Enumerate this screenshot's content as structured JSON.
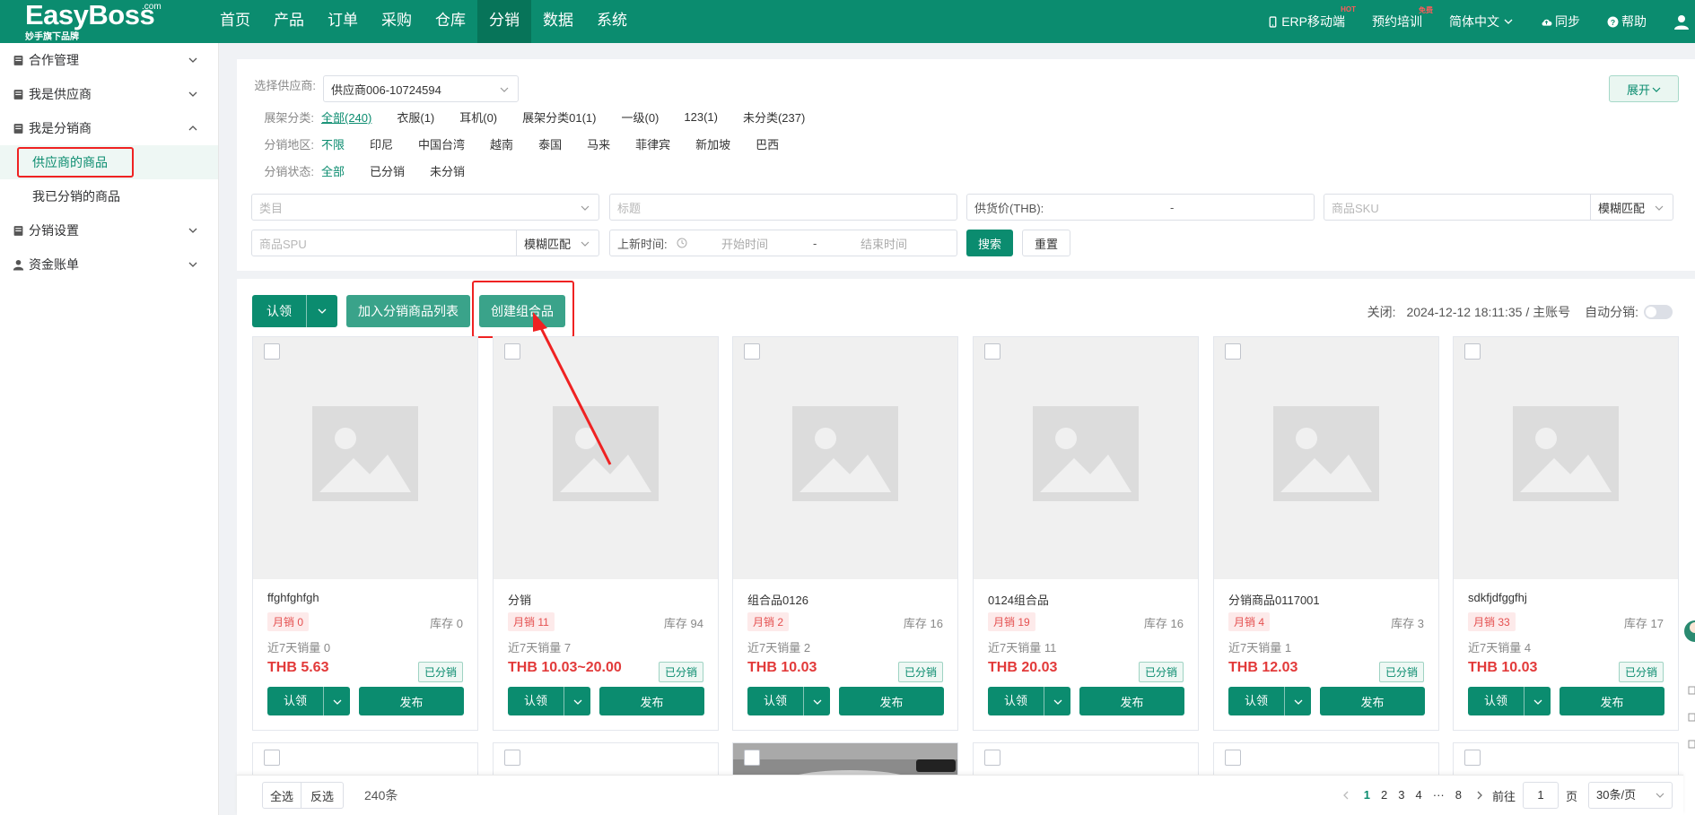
{
  "brand": {
    "name": "EasyBoss",
    "suffix": ".com",
    "tagline": "妙手旗下品牌"
  },
  "topnav": [
    "首页",
    "产品",
    "订单",
    "采购",
    "仓库",
    "分销",
    "数据",
    "系统"
  ],
  "topnav_active": "分销",
  "right_nav": {
    "mobile": "ERP移动端",
    "mobile_badge": "HOT",
    "training": "预约培训",
    "training_badge": "免费",
    "language": "简体中文",
    "sync": "同步",
    "help": "帮助"
  },
  "sidebar": {
    "menu1": "合作管理",
    "menu2": "我是供应商",
    "menu3": "我是分销商",
    "sub1": "供应商的商品",
    "sub2": "我已分销的商品",
    "menu4": "分销设置",
    "menu5": "资金账单"
  },
  "filters": {
    "supplier_label": "选择供应商:",
    "supplier_value": "供应商006-10724594",
    "expand": "展开",
    "shelf_label": "展架分类:",
    "shelf_options": [
      "全部(240)",
      "衣服(1)",
      "耳机(0)",
      "展架分类01(1)",
      "一级(0)",
      "123(1)",
      "未分类(237)"
    ],
    "region_label": "分销地区:",
    "region_options": [
      "不限",
      "印尼",
      "中国台湾",
      "越南",
      "泰国",
      "马来",
      "菲律宾",
      "新加坡",
      "巴西"
    ],
    "status_label": "分销状态:",
    "status_options": [
      "全部",
      "已分销",
      "未分销"
    ],
    "category_ph": "类目",
    "title_ph": "标题",
    "price_label": "供货价(THB):",
    "price_sep": "-",
    "sku_ph": "商品SKU",
    "match1": "模糊匹配",
    "spu_ph": "商品SPU",
    "match2": "模糊匹配",
    "new_time_label": "上新时间:",
    "start_ph": "开始时间",
    "time_sep": "-",
    "end_ph": "结束时间",
    "search": "搜索",
    "reset": "重置"
  },
  "actions": {
    "claim": "认领",
    "add_list": "加入分销商品列表",
    "create_combo": "创建组合品",
    "closed_label": "关闭:",
    "closed_value": "2024-12-12 18:11:35 / 主账号",
    "auto_label": "自动分销:"
  },
  "products": [
    {
      "name": "ffghfghfgh",
      "monthly": "月销 0",
      "stock": "库存 0",
      "week": "近7天销量 0",
      "price": "THB 5.63",
      "status": "已分销"
    },
    {
      "name": "分销",
      "monthly": "月销 11",
      "stock": "库存 94",
      "week": "近7天销量 7",
      "price": "THB 10.03~20.00",
      "status": "已分销"
    },
    {
      "name": "组合品0126",
      "monthly": "月销 2",
      "stock": "库存 16",
      "week": "近7天销量 2",
      "price": "THB 10.03",
      "status": "已分销"
    },
    {
      "name": "0124组合品",
      "monthly": "月销 19",
      "stock": "库存 16",
      "week": "近7天销量 11",
      "price": "THB 20.03",
      "status": "已分销"
    },
    {
      "name": "分销商品0117001",
      "monthly": "月销 4",
      "stock": "库存 3",
      "week": "近7天销量 1",
      "price": "THB 12.03",
      "status": "已分销"
    },
    {
      "name": "sdkfjdfggfhj",
      "monthly": "月销 33",
      "stock": "库存 17",
      "week": "近7天销量 4",
      "price": "THB 10.03",
      "status": "已分销"
    }
  ],
  "card_buttons": {
    "claim": "认领",
    "publish": "发布"
  },
  "bottom": {
    "select_all": "全选",
    "invert": "反选",
    "count": "240条",
    "pages": [
      "1",
      "2",
      "3",
      "4",
      "···",
      "8"
    ],
    "current_page": "1",
    "goto_label": "前往",
    "goto_value": "1",
    "page_unit": "页",
    "page_size": "30条/页"
  },
  "colors": {
    "primary": "#0b8c6f",
    "primary_dark": "#077459",
    "price": "#e23a3a",
    "annotation": "#ef2222"
  }
}
